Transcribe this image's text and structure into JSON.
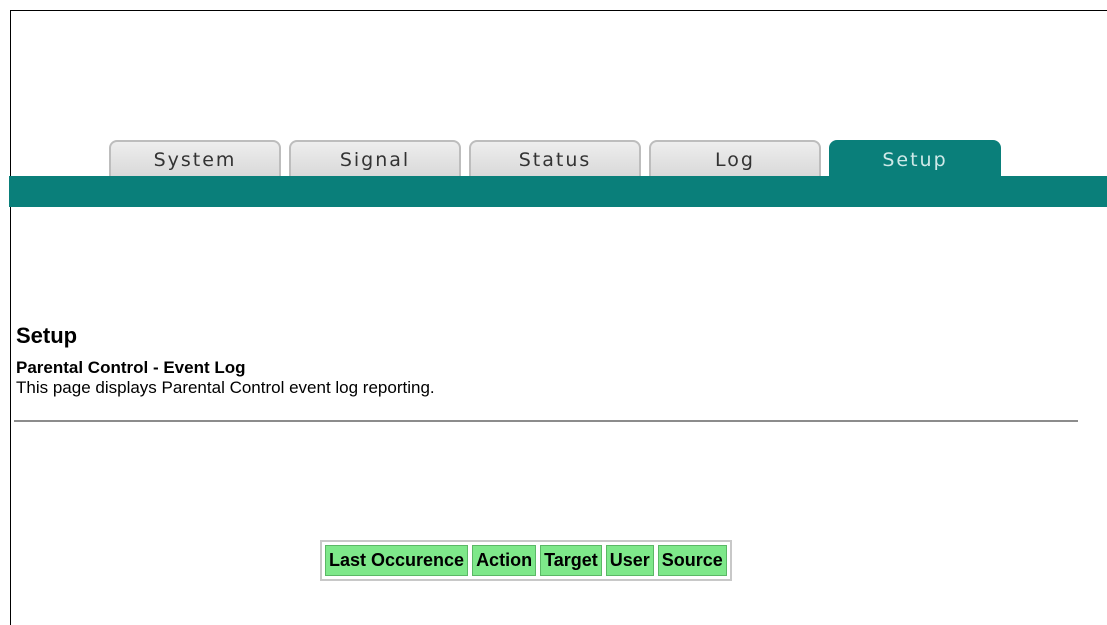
{
  "nav": {
    "tabs": [
      {
        "label": "System",
        "active": false
      },
      {
        "label": "Signal",
        "active": false
      },
      {
        "label": "Status",
        "active": false
      },
      {
        "label": "Log",
        "active": false
      },
      {
        "label": "Setup",
        "active": true
      }
    ]
  },
  "page": {
    "title": "Setup",
    "subtitle": "Parental Control - Event Log",
    "description": "This page displays Parental Control event log reporting."
  },
  "event_log": {
    "columns": [
      "Last Occurence",
      "Action",
      "Target",
      "User",
      "Source"
    ],
    "rows": []
  },
  "colors": {
    "accent": "#0a7f7a",
    "tab_inactive": "#e3e3e3",
    "header_cell": "#7ee88a"
  }
}
